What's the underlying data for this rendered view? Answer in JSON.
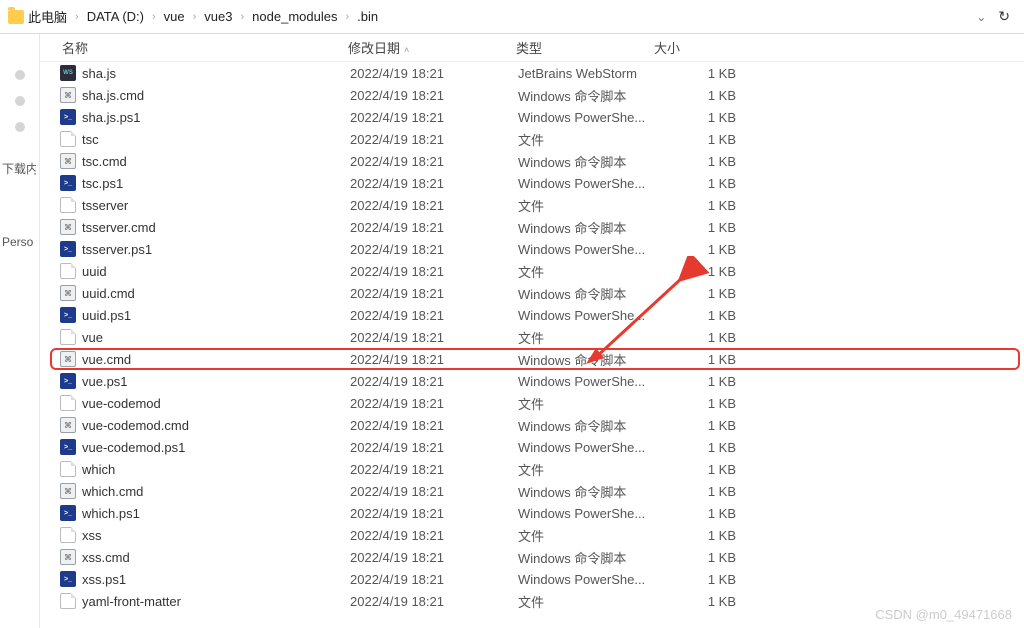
{
  "breadcrumb": [
    "此电脑",
    "DATA (D:)",
    "vue",
    "vue3",
    "node_modules",
    ".bin"
  ],
  "columns": {
    "name": "名称",
    "date": "修改日期",
    "type": "类型",
    "size": "大小"
  },
  "sidebar": {
    "item1": "下载内容",
    "item2": "Perso"
  },
  "common_date": "2022/4/19 18:21",
  "common_size": "1 KB",
  "types": {
    "ws": "JetBrains WebStorm",
    "cmd": "Windows 命令脚本",
    "ps": "Windows PowerShe...",
    "file": "文件"
  },
  "files": [
    {
      "icon": "ws",
      "name": "sha.js",
      "typeKey": "ws"
    },
    {
      "icon": "cmd",
      "name": "sha.js.cmd",
      "typeKey": "cmd"
    },
    {
      "icon": "ps",
      "name": "sha.js.ps1",
      "typeKey": "ps"
    },
    {
      "icon": "file",
      "name": "tsc",
      "typeKey": "file"
    },
    {
      "icon": "cmd",
      "name": "tsc.cmd",
      "typeKey": "cmd"
    },
    {
      "icon": "ps",
      "name": "tsc.ps1",
      "typeKey": "ps"
    },
    {
      "icon": "file",
      "name": "tsserver",
      "typeKey": "file"
    },
    {
      "icon": "cmd",
      "name": "tsserver.cmd",
      "typeKey": "cmd"
    },
    {
      "icon": "ps",
      "name": "tsserver.ps1",
      "typeKey": "ps"
    },
    {
      "icon": "file",
      "name": "uuid",
      "typeKey": "file"
    },
    {
      "icon": "cmd",
      "name": "uuid.cmd",
      "typeKey": "cmd"
    },
    {
      "icon": "ps",
      "name": "uuid.ps1",
      "typeKey": "ps"
    },
    {
      "icon": "file",
      "name": "vue",
      "typeKey": "file"
    },
    {
      "icon": "cmd",
      "name": "vue.cmd",
      "typeKey": "cmd",
      "highlighted": true
    },
    {
      "icon": "ps",
      "name": "vue.ps1",
      "typeKey": "ps"
    },
    {
      "icon": "file",
      "name": "vue-codemod",
      "typeKey": "file"
    },
    {
      "icon": "cmd",
      "name": "vue-codemod.cmd",
      "typeKey": "cmd"
    },
    {
      "icon": "ps",
      "name": "vue-codemod.ps1",
      "typeKey": "ps"
    },
    {
      "icon": "file",
      "name": "which",
      "typeKey": "file"
    },
    {
      "icon": "cmd",
      "name": "which.cmd",
      "typeKey": "cmd"
    },
    {
      "icon": "ps",
      "name": "which.ps1",
      "typeKey": "ps"
    },
    {
      "icon": "file",
      "name": "xss",
      "typeKey": "file"
    },
    {
      "icon": "cmd",
      "name": "xss.cmd",
      "typeKey": "cmd"
    },
    {
      "icon": "ps",
      "name": "xss.ps1",
      "typeKey": "ps"
    },
    {
      "icon": "file",
      "name": "yaml-front-matter",
      "typeKey": "file"
    }
  ],
  "watermark": "CSDN @m0_49471668"
}
